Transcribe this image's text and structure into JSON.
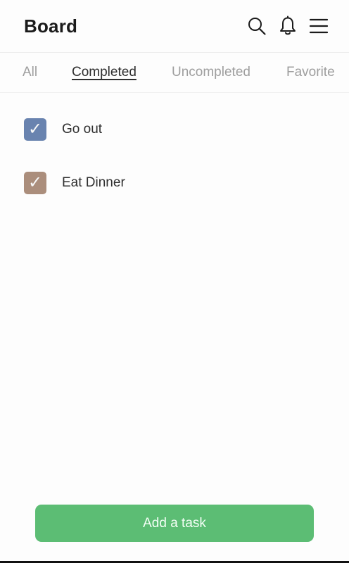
{
  "header": {
    "title": "Board"
  },
  "icons": {
    "search": "search-icon",
    "notifications": "bell-icon",
    "menu": "hamburger-menu-icon"
  },
  "tabs": [
    {
      "label": "All",
      "active": false
    },
    {
      "label": "Completed",
      "active": true
    },
    {
      "label": "Uncompleted",
      "active": false
    },
    {
      "label": "Favorite",
      "active": false
    }
  ],
  "tasks": [
    {
      "label": "Go out",
      "checked": true,
      "color": "#6c87b4",
      "checkmark": "✓"
    },
    {
      "label": "Eat Dinner",
      "checked": true,
      "color": "#b09280",
      "checkmark": "✓"
    }
  ],
  "footer": {
    "add_button_label": "Add a task",
    "add_button_color": "#5cbd74"
  }
}
